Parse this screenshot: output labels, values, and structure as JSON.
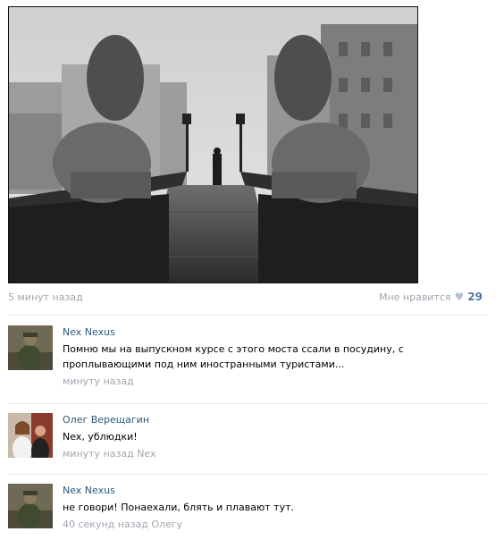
{
  "post": {
    "time": "5 минут назад",
    "like_label": "Мне нравится",
    "like_count": "29",
    "like_icon": "heart-icon"
  },
  "comments": [
    {
      "author": "Nex Nexus",
      "text": "Помню мы на выпускном курсе с этого моста ссали в посудину, с проплывающими под ним иностранными туристами...",
      "date": "минуту назад"
    },
    {
      "author": "Олег Верещагин",
      "text": "Nex, ублюдки!",
      "date": "минуту назад Nex"
    },
    {
      "author": "Nex Nexus",
      "text": "не говори! Понаехали, блять и плавают тут.",
      "date": "40 секунд назад Олегу"
    }
  ],
  "colors": {
    "link": "#2b587a",
    "muted": "#a0a6ae",
    "like_count": "#55779d"
  }
}
